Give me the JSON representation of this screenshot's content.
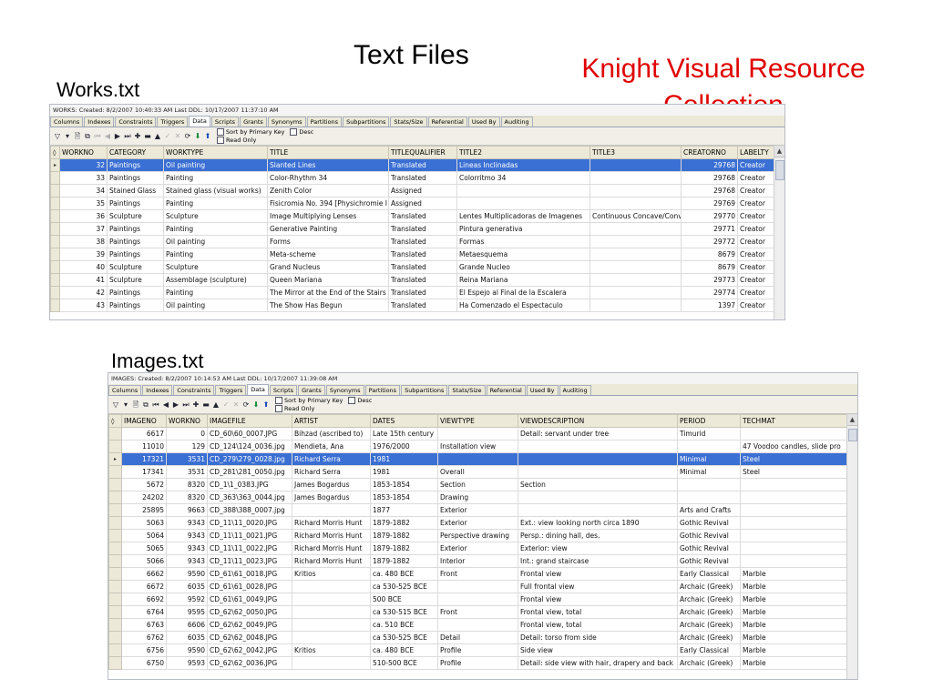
{
  "slide": {
    "title": "Text Files",
    "brand_line1": "Knight Visual Resource",
    "brand_line2": "Collection",
    "works_label": "Works.txt",
    "images_label": "Images.txt"
  },
  "colors": {
    "brand": "#e00000",
    "selection": "#3a6fd3",
    "tab_bg": "#ece9d8"
  },
  "works": {
    "info": "WORKS:   Created: 8/2/2007 10:40:33 AM   Last DDL: 10/17/2007 11:37:10 AM",
    "tabs": [
      "Columns",
      "Indexes",
      "Constraints",
      "Triggers",
      "Data",
      "Scripts",
      "Grants",
      "Synonyms",
      "Partitions",
      "Subpartitions",
      "Stats/Size",
      "Referential",
      "Used By",
      "Auditing"
    ],
    "active_tab": "Data",
    "sort_label": "Sort by Primary Key",
    "desc_label": "Desc",
    "readonly_label": "Read Only",
    "columns": [
      "WORKNO",
      "CATEGORY",
      "WORKTYPE",
      "TITLE",
      "TITLEQUALIFIER",
      "TITLE2",
      "TITLE3",
      "CREATORNO",
      "LABELTY"
    ],
    "rows": [
      [
        "32",
        "Paintings",
        "Oil painting",
        "Slanted Lines",
        "Translated",
        "Lineas Inclinadas",
        "",
        "29768",
        "Creator"
      ],
      [
        "33",
        "Paintings",
        "Painting",
        "Color-Rhythm 34",
        "Translated",
        "Colorritmo 34",
        "",
        "29768",
        "Creator"
      ],
      [
        "34",
        "Stained Glass",
        "Stained glass (visual works)",
        "Zenith Color",
        "Assigned",
        "",
        "",
        "29768",
        "Creator"
      ],
      [
        "35",
        "Paintings",
        "Painting",
        "Fisicromia No. 394 [Physichromie I",
        "Assigned",
        "",
        "",
        "29769",
        "Creator"
      ],
      [
        "36",
        "Sculpture",
        "Sculpture",
        "Image Multiplying Lenses",
        "Translated",
        "Lentes Multiplicadoras de Imagenes",
        "Continuous Concave/Conv",
        "29770",
        "Creator"
      ],
      [
        "37",
        "Paintings",
        "Painting",
        "Generative Painting",
        "Translated",
        "Pintura generativa",
        "",
        "29771",
        "Creator"
      ],
      [
        "38",
        "Paintings",
        "Oil painting",
        "Forms",
        "Translated",
        "Formas",
        "",
        "29772",
        "Creator"
      ],
      [
        "39",
        "Paintings",
        "Painting",
        "Meta-scheme",
        "Translated",
        "Metaesquema",
        "",
        "8679",
        "Creator"
      ],
      [
        "40",
        "Sculpture",
        "Sculpture",
        "Grand Nucleus",
        "Translated",
        "Grande Nucleo",
        "",
        "8679",
        "Creator"
      ],
      [
        "41",
        "Sculpture",
        "Assemblage (sculpture)",
        "Queen Mariana",
        "Translated",
        "Reina Mariana",
        "",
        "29773",
        "Creator"
      ],
      [
        "42",
        "Paintings",
        "Painting",
        "The Mirror at the End of the Stairs",
        "Translated",
        "El Espejo al Final de la Escalera",
        "",
        "29774",
        "Creator"
      ],
      [
        "43",
        "Paintings",
        "Oil painting",
        "The Show Has Begun",
        "Translated",
        "Ha Comenzado el Espectaculo",
        "",
        "1397",
        "Creator"
      ]
    ]
  },
  "images": {
    "info": "IMAGES:   Created: 8/2/2007 10:14:53 AM   Last DDL: 10/17/2007 11:39:08 AM",
    "tabs": [
      "Columns",
      "Indexes",
      "Constraints",
      "Triggers",
      "Data",
      "Scripts",
      "Grants",
      "Synonyms",
      "Partitions",
      "Subpartitions",
      "Stats/Size",
      "Referential",
      "Used By",
      "Auditing"
    ],
    "active_tab": "Data",
    "sort_label": "Sort by Primary Key",
    "desc_label": "Desc",
    "readonly_label": "Read Only",
    "columns": [
      "IMAGENO",
      "WORKNO",
      "IMAGEFILE",
      "ARTIST",
      "DATES",
      "VIEWTYPE",
      "VIEWDESCRIPTION",
      "PERIOD",
      "TECHMAT"
    ],
    "rows": [
      [
        "6617",
        "0",
        "CD_60\\60_0007.JPG",
        "Bihzad (ascribed to)",
        "Late 15th century",
        "",
        "Detail: servant under tree",
        "Timurid",
        ""
      ],
      [
        "11010",
        "129",
        "CD_124\\124_0036.jpg",
        "Mendieta, Ana",
        "1976/2000",
        "Installation view",
        "",
        "",
        "47 Voodoo candles, slide pro"
      ],
      [
        "17321",
        "3531",
        "CD_279\\279_0028.jpg",
        "Richard Serra",
        "1981",
        "",
        "",
        "Minimal",
        "Steel"
      ],
      [
        "17341",
        "3531",
        "CD_281\\281_0050.jpg",
        "Richard Serra",
        "1981",
        "Overall",
        "",
        "Minimal",
        "Steel"
      ],
      [
        "5672",
        "8320",
        "CD_1\\1_0383.JPG",
        "James Bogardus",
        "1853-1854",
        "Section",
        "Section",
        "",
        ""
      ],
      [
        "24202",
        "8320",
        "CD_363\\363_0044.jpg",
        "James Bogardus",
        "1853-1854",
        "Drawing",
        "",
        "",
        ""
      ],
      [
        "25895",
        "9663",
        "CD_388\\388_0007.jpg",
        "",
        "1877",
        "Exterior",
        "",
        "Arts and Crafts",
        ""
      ],
      [
        "5063",
        "9343",
        "CD_11\\11_0020.JPG",
        "Richard Morris Hunt",
        "1879-1882",
        "Exterior",
        "Ext.: view looking north circa 1890",
        "Gothic Revival",
        ""
      ],
      [
        "5064",
        "9343",
        "CD_11\\11_0021.JPG",
        "Richard Morris Hunt",
        "1879-1882",
        "Perspective drawing",
        "Persp.: dining hall, des.",
        "Gothic Revival",
        ""
      ],
      [
        "5065",
        "9343",
        "CD_11\\11_0022.JPG",
        "Richard Morris Hunt",
        "1879-1882",
        "Exterior",
        "Exterior: view",
        "Gothic Revival",
        ""
      ],
      [
        "5066",
        "9343",
        "CD_11\\11_0023.JPG",
        "Richard Morris Hunt",
        "1879-1882",
        "Interior",
        "Int.: grand staircase",
        "Gothic Revival",
        ""
      ],
      [
        "6662",
        "9590",
        "CD_61\\61_0018.JPG",
        "Kritios",
        "ca. 480 BCE",
        "Front",
        "Frontal view",
        "Early Classical",
        "Marble"
      ],
      [
        "6672",
        "6035",
        "CD_61\\61_0028.JPG",
        "",
        "ca 530-525 BCE",
        "",
        "Full frontal view",
        "Archaic (Greek)",
        "Marble"
      ],
      [
        "6692",
        "9592",
        "CD_61\\61_0049.JPG",
        "",
        "500 BCE",
        "",
        "Frontal view",
        "Archaic (Greek)",
        "Marble"
      ],
      [
        "6764",
        "9595",
        "CD_62\\62_0050.JPG",
        "",
        "ca 530-515 BCE",
        "Front",
        "Frontal view, total",
        "Archaic (Greek)",
        "Marble"
      ],
      [
        "6763",
        "6606",
        "CD_62\\62_0049.JPG",
        "",
        "ca. 510 BCE",
        "",
        "Frontal view, total",
        "Archaic (Greek)",
        "Marble"
      ],
      [
        "6762",
        "6035",
        "CD_62\\62_0048.JPG",
        "",
        "ca 530-525 BCE",
        "Detail",
        "Detail: torso from side",
        "Archaic (Greek)",
        "Marble"
      ],
      [
        "6756",
        "9590",
        "CD_62\\62_0042.JPG",
        "Kritios",
        "ca. 480 BCE",
        "Profile",
        "Side view",
        "Early Classical",
        "Marble"
      ],
      [
        "6750",
        "9593",
        "CD_62\\62_0036.JPG",
        "",
        "510-500 BCE",
        "Profile",
        "Detail: side view with hair, drapery and back",
        "Archaic (Greek)",
        "Marble"
      ]
    ]
  }
}
